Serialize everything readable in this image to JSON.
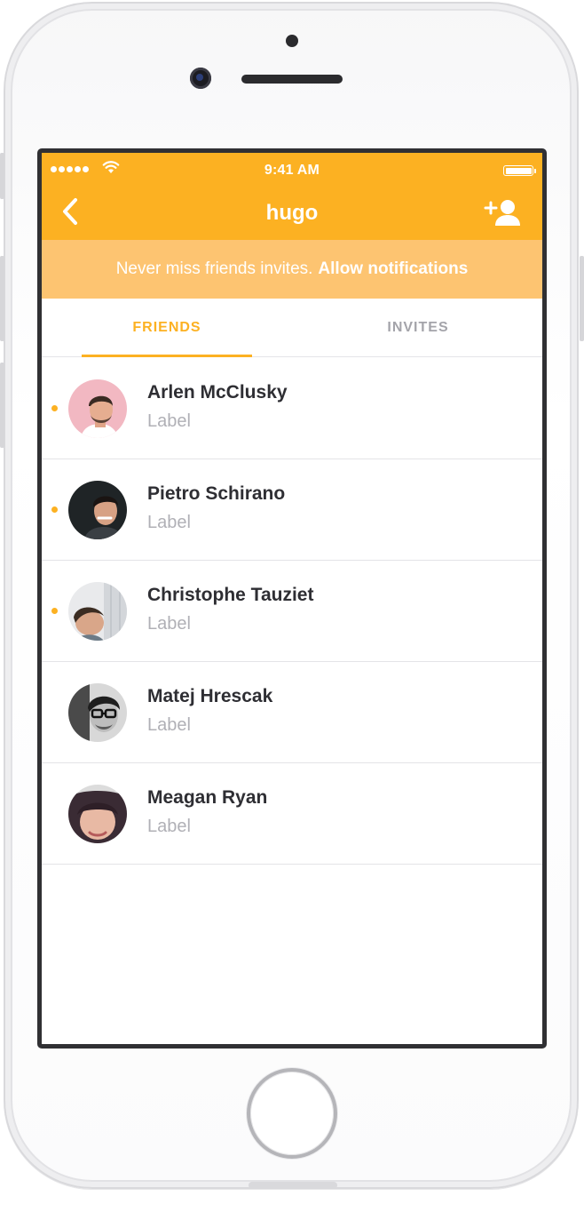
{
  "status_bar": {
    "time": "9:41 AM",
    "signal_icon": "signal-dots-icon",
    "wifi_icon": "wifi-icon",
    "battery_icon": "battery-icon",
    "battery_level": 1.0
  },
  "nav": {
    "title": "hugo",
    "back_icon": "chevron-left-icon",
    "add_icon": "add-person-icon"
  },
  "banner": {
    "text": "Never miss friends invites.",
    "link": "Allow notifications"
  },
  "tabs": [
    {
      "label": "FRIENDS",
      "active": true
    },
    {
      "label": "INVITES",
      "active": false
    }
  ],
  "friends": [
    {
      "name": "Arlen McClusky",
      "subtitle": "Label",
      "unread": true
    },
    {
      "name": "Pietro Schirano",
      "subtitle": "Label",
      "unread": true
    },
    {
      "name": "Christophe Tauziet",
      "subtitle": "Label",
      "unread": true
    },
    {
      "name": "Matej Hrescak",
      "subtitle": "Label",
      "unread": false
    },
    {
      "name": "Meagan Ryan",
      "subtitle": "Label",
      "unread": false
    }
  ],
  "colors": {
    "accent": "#fcb122",
    "banner": "#fdc471",
    "text_primary": "#2e2e33",
    "text_secondary": "#b0b0b6"
  }
}
